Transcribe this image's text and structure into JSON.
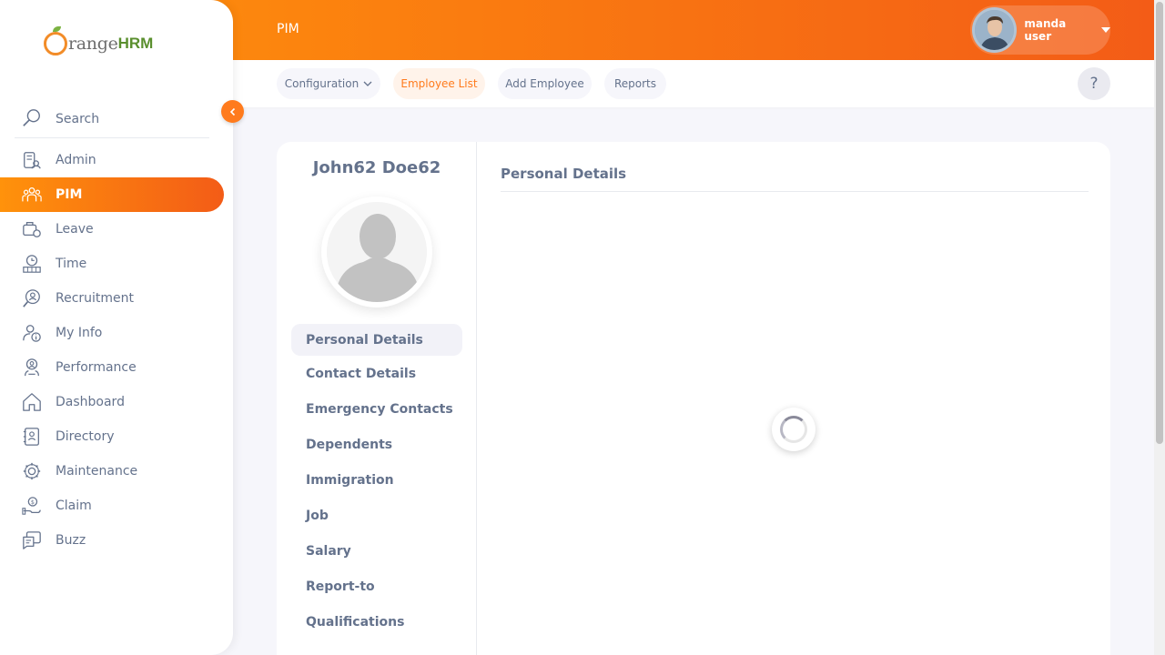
{
  "app": {
    "brand_main": "range",
    "brand_suffix": "HRM",
    "brand_color": "#f28c28"
  },
  "sidebar": {
    "search_label": "Search",
    "items": [
      {
        "label": "Admin",
        "icon": "admin-icon"
      },
      {
        "label": "PIM",
        "icon": "pim-icon",
        "active": true
      },
      {
        "label": "Leave",
        "icon": "leave-icon"
      },
      {
        "label": "Time",
        "icon": "time-icon"
      },
      {
        "label": "Recruitment",
        "icon": "recruitment-icon"
      },
      {
        "label": "My Info",
        "icon": "my-info-icon"
      },
      {
        "label": "Performance",
        "icon": "performance-icon"
      },
      {
        "label": "Dashboard",
        "icon": "dashboard-icon"
      },
      {
        "label": "Directory",
        "icon": "directory-icon"
      },
      {
        "label": "Maintenance",
        "icon": "maintenance-icon"
      },
      {
        "label": "Claim",
        "icon": "claim-icon"
      },
      {
        "label": "Buzz",
        "icon": "buzz-icon"
      }
    ]
  },
  "header": {
    "title": "PIM",
    "user_name": "manda user",
    "accent": "#ff7b1d"
  },
  "subnav": {
    "tabs": [
      {
        "label": "Configuration"
      },
      {
        "label": "Employee List",
        "active": true
      },
      {
        "label": "Add Employee"
      },
      {
        "label": "Reports"
      }
    ],
    "help": "?"
  },
  "employee": {
    "name": "John62 Doe62",
    "tabs": [
      {
        "label": "Personal Details",
        "active": true
      },
      {
        "label": "Contact Details"
      },
      {
        "label": "Emergency Contacts"
      },
      {
        "label": "Dependents"
      },
      {
        "label": "Immigration"
      },
      {
        "label": "Job"
      },
      {
        "label": "Salary"
      },
      {
        "label": "Report-to"
      },
      {
        "label": "Qualifications"
      }
    ],
    "section_title": "Personal Details"
  }
}
